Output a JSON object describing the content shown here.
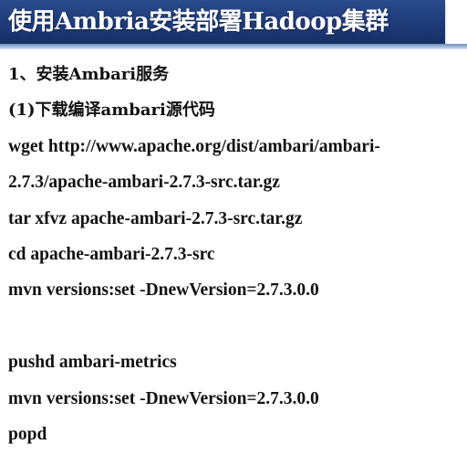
{
  "slide": {
    "title": "使用Ambria安装部署Hadoop集群",
    "lines": [
      "1、安装Ambari服务",
      "(1)下载编译ambari源代码",
      "wget http://www.apache.org/dist/ambari/ambari-",
      "2.7.3/apache-ambari-2.7.3-src.tar.gz",
      "tar xfvz apache-ambari-2.7.3-src.tar.gz",
      "cd apache-ambari-2.7.3-src",
      "mvn versions:set -DnewVersion=2.7.3.0.0",
      "",
      "pushd ambari-metrics",
      "mvn versions:set -DnewVersion=2.7.3.0.0",
      "popd"
    ]
  },
  "colors": {
    "title_bar": "#1e3a78",
    "title_text": "#ffffff",
    "body_text": "#111111"
  }
}
